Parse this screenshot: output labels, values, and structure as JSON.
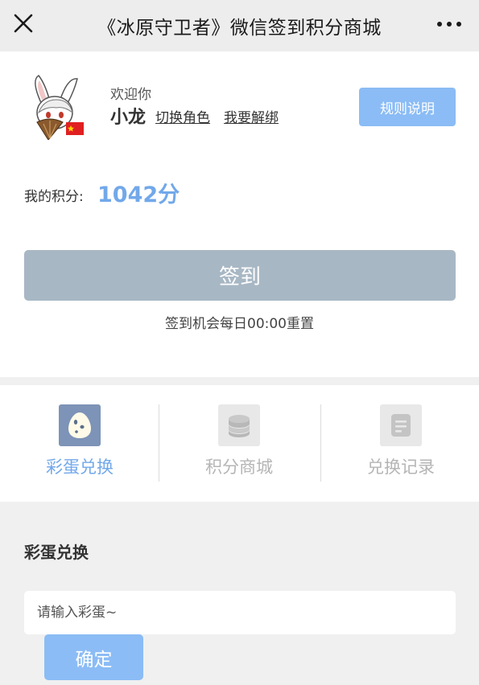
{
  "navbar": {
    "title": "《冰原守卫者》微信签到积分商城",
    "close_icon": "close-icon",
    "more_icon": "more-icon"
  },
  "profile": {
    "avatar_icon": "rabbit-avatar",
    "welcome": "欢迎你",
    "nickname": "小龙",
    "switch_role": "切换角色",
    "unbind": "我要解绑",
    "rules_button": "规则说明",
    "points_label": "我的积分:",
    "points_value": "1042分",
    "checkin_button": "签到",
    "checkin_note": "签到机会每日00:00重置"
  },
  "tabs": [
    {
      "label": "彩蛋兑换",
      "icon": "egg-icon",
      "active": true
    },
    {
      "label": "积分商城",
      "icon": "coins-icon",
      "active": false
    },
    {
      "label": "兑换记录",
      "icon": "document-icon",
      "active": false
    }
  ],
  "egg": {
    "title": "彩蛋兑换",
    "placeholder": "请输入彩蛋~",
    "confirm_button": "确定"
  },
  "colors": {
    "accent": "#8bbcf5",
    "points": "#72a8ea",
    "tab_active_bg": "#7d93b7",
    "tab_inactive_bg": "#e8e8e8",
    "tab_active_text": "#72a8ea",
    "tab_inactive_text": "#b5b5b5",
    "checkin_disabled": "#a8b7c4"
  }
}
